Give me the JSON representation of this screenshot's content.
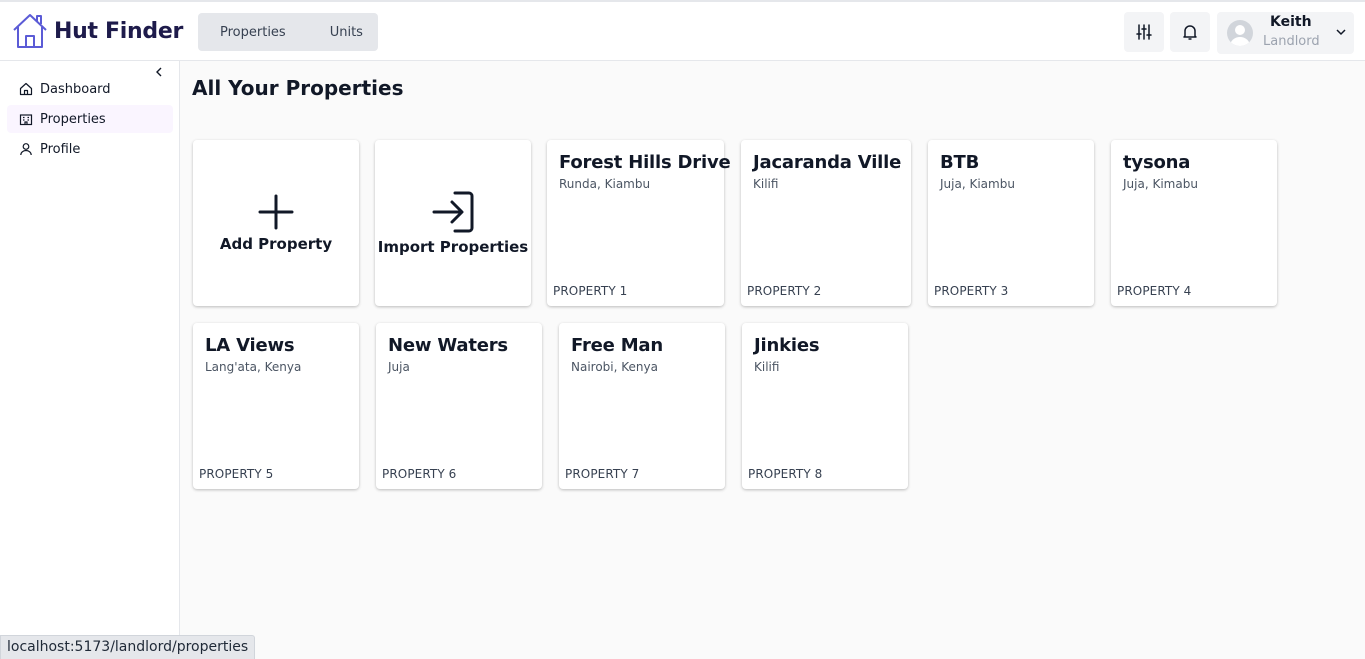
{
  "app": {
    "title": "Hut Finder"
  },
  "header": {
    "segments": [
      "Properties",
      "Units"
    ],
    "user": {
      "name": "Keith",
      "role": "Landlord"
    }
  },
  "sidebar": {
    "items": [
      {
        "label": "Dashboard",
        "icon": "home-icon"
      },
      {
        "label": "Properties",
        "icon": "building-icon",
        "active": true
      },
      {
        "label": "Profile",
        "icon": "user-icon"
      }
    ]
  },
  "main": {
    "title": "All Your Properties",
    "actions": [
      {
        "label": "Add Property",
        "icon": "plus-icon"
      },
      {
        "label": "Import Properties",
        "icon": "import-icon"
      }
    ],
    "properties": [
      {
        "name": "Forest Hills Drive",
        "location": "Runda, Kiambu",
        "tag": "PROPERTY 1"
      },
      {
        "name": "Jacaranda Ville",
        "location": "Kilifi",
        "tag": "PROPERTY 2"
      },
      {
        "name": "BTB",
        "location": "Juja, Kiambu",
        "tag": "PROPERTY 3"
      },
      {
        "name": "tysona",
        "location": "Juja, Kimabu",
        "tag": "PROPERTY 4"
      },
      {
        "name": "LA Views",
        "location": "Lang'ata, Kenya",
        "tag": "PROPERTY 5"
      },
      {
        "name": "New Waters",
        "location": "Juja",
        "tag": "PROPERTY 6"
      },
      {
        "name": "Free Man",
        "location": "Nairobi, Kenya",
        "tag": "PROPERTY 7"
      },
      {
        "name": "Jinkies",
        "location": "Kilifi",
        "tag": "PROPERTY 8"
      }
    ]
  },
  "status_bar": {
    "url": "localhost:5173/landlord/properties"
  },
  "colors": {
    "brand": "#1e1b4b",
    "logo_accent": "#5b5bd6",
    "active_nav": "#faf5ff"
  }
}
